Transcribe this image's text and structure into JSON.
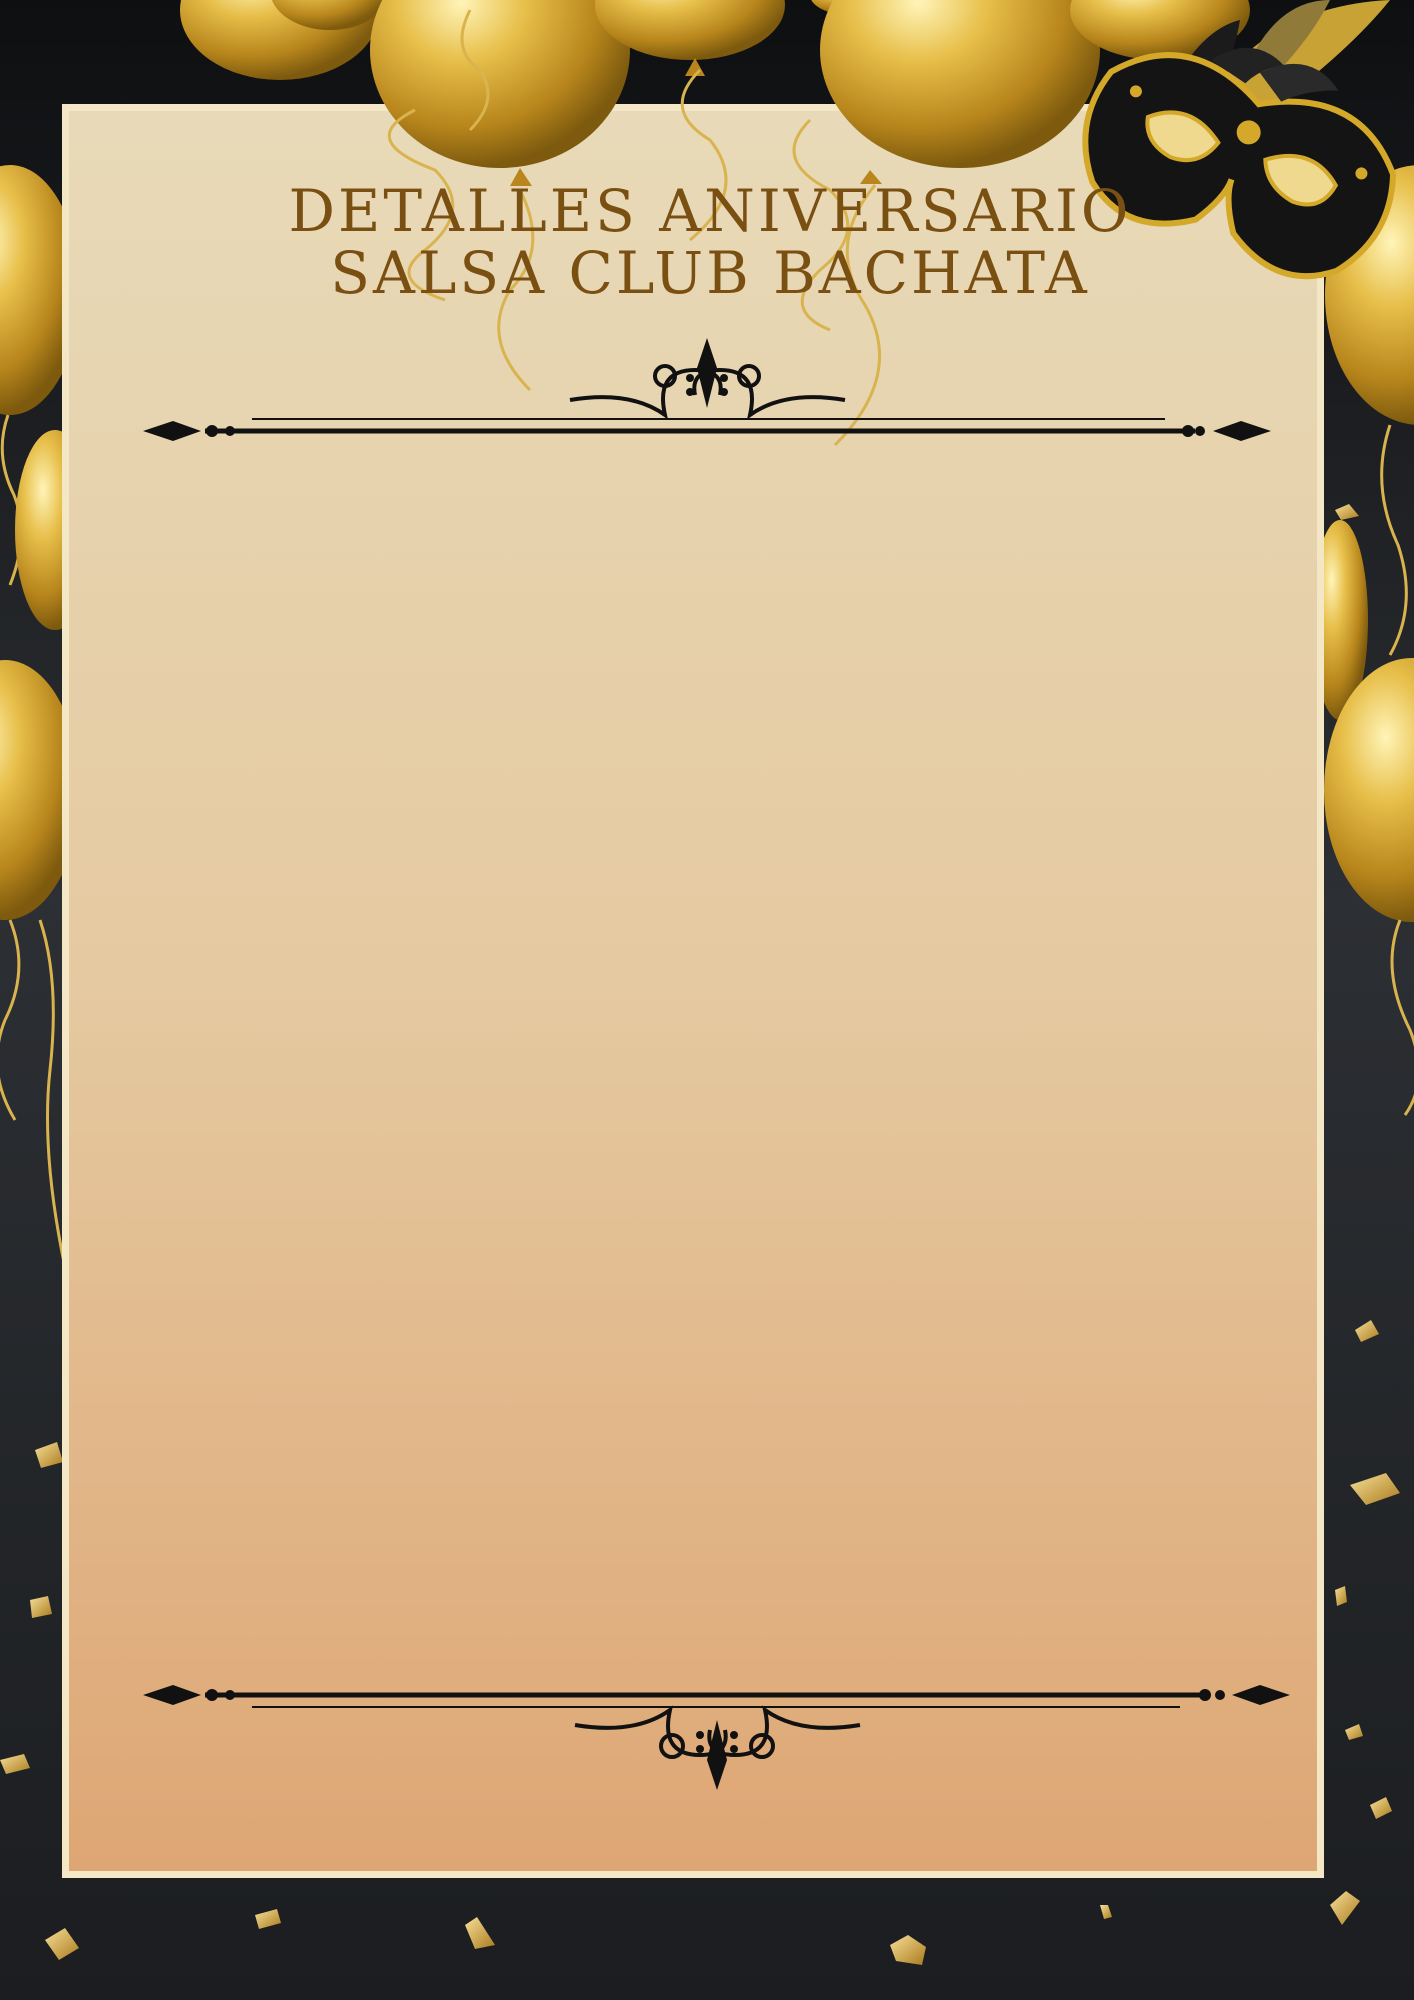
{
  "poster": {
    "title_line_1": "DETALLES ANIVERSARIO",
    "title_line_2": "SALSA CLUB BACHATA"
  },
  "colors": {
    "background": "#1b1d20",
    "panel_top": "#e8dab8",
    "panel_bottom": "#dea674",
    "panel_border": "#f3e7c6",
    "title": "#7a4f12",
    "gold": "#d4a829",
    "ornament": "#111111"
  },
  "icons": [
    "balloon-icon",
    "mask-icon",
    "feather-icon",
    "confetti-icon",
    "scroll-ornament-icon"
  ]
}
